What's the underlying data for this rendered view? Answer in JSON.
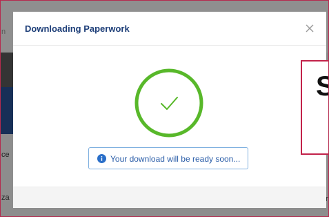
{
  "modal": {
    "title": "Downloading Paperwork",
    "close_symbol": "×",
    "status_icon": "check-circle-icon",
    "info": {
      "icon": "info-icon",
      "message": "Your download will be ready soon..."
    }
  },
  "background": {
    "fragment_left_1": "ce",
    "fragment_left_2": "za",
    "fragment_right_1": "n",
    "fragment_top": "n"
  },
  "callout": {
    "visible_letter": "S"
  },
  "colors": {
    "title": "#1d3e78",
    "success_ring": "#58b82a",
    "info_border": "#7fb0e0",
    "info_text": "#2a5da8",
    "callout_border": "#c2224a",
    "backdrop": "#8a8a8a"
  }
}
